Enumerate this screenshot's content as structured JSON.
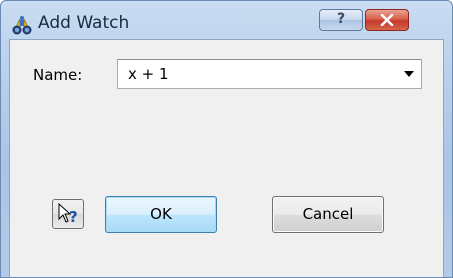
{
  "window": {
    "title": "Add Watch",
    "title_icon": "watch-binoculars-icon",
    "help_glyph": "?",
    "help_icon": "help-icon",
    "close_icon": "close-icon"
  },
  "form": {
    "name_label": "Name:",
    "name_value": "x + 1",
    "dropdown_icon": "chevron-down-icon"
  },
  "buttons": {
    "whats_this_icon": "context-help-icon",
    "ok_label": "OK",
    "cancel_label": "Cancel"
  },
  "colors": {
    "close_button": "#c5382a",
    "default_button_border": "#3c7fb1",
    "title_bar": "#b7cfeb"
  }
}
